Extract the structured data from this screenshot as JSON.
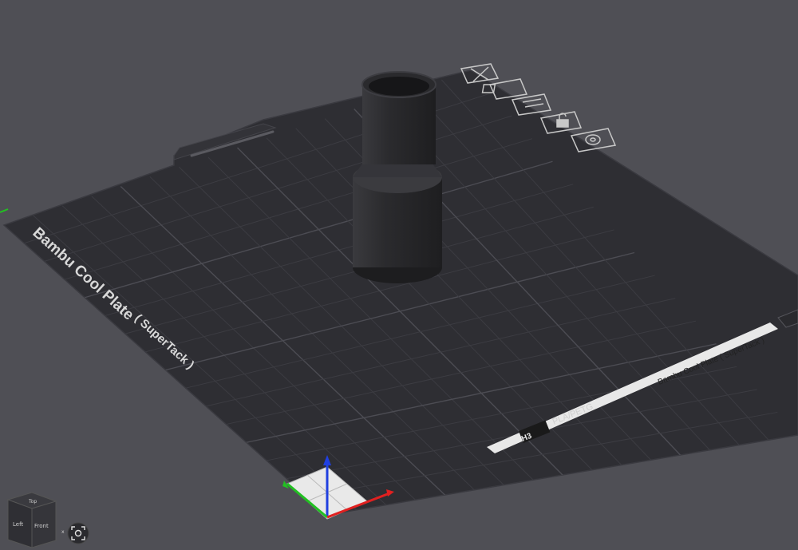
{
  "plate": {
    "name_main": "Bambu Cool Plate",
    "name_sub": "( SuperTack )",
    "strip_label": "Bambu Cool Plate ( SuperTack )",
    "material": "PLA/PETG",
    "logo": "H3"
  },
  "view_cube": {
    "face_top": "Top",
    "face_front": "Front",
    "face_left": "Left",
    "axis_x": "x"
  },
  "plate_toolbar": {
    "icons": [
      "delete-plate-icon",
      "arrange-icon",
      "orient-icon",
      "lock-icon",
      "settings-icon"
    ]
  },
  "colors": {
    "background": "#4f4f55",
    "plate": "#2e2e33",
    "grid": "#44444a",
    "axis_x": "#e02020",
    "axis_y": "#22c022",
    "axis_z": "#2040e0",
    "model": "#2a2a2d"
  }
}
